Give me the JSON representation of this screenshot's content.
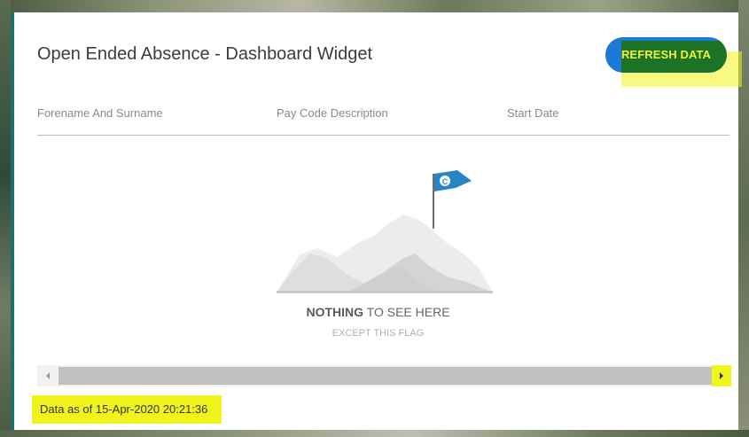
{
  "widget": {
    "title": "Open Ended Absence - Dashboard Widget",
    "refresh_label": "REFRESH DATA"
  },
  "table": {
    "columns": [
      {
        "label": "Forename And Surname"
      },
      {
        "label": "Pay Code Description"
      },
      {
        "label": "Start Date"
      }
    ]
  },
  "empty_state": {
    "title_strong": "NOTHING",
    "title_rest": " TO SEE HERE",
    "subtitle": "EXCEPT THIS FLAG",
    "flag_letter": "C"
  },
  "footer": {
    "data_as_of": "Data as of 15-Apr-2020 20:21:36"
  },
  "colors": {
    "accent_blue": "#1e78d6",
    "highlight_yellow": "#f1f41c",
    "flag_blue": "#2a83c6"
  }
}
